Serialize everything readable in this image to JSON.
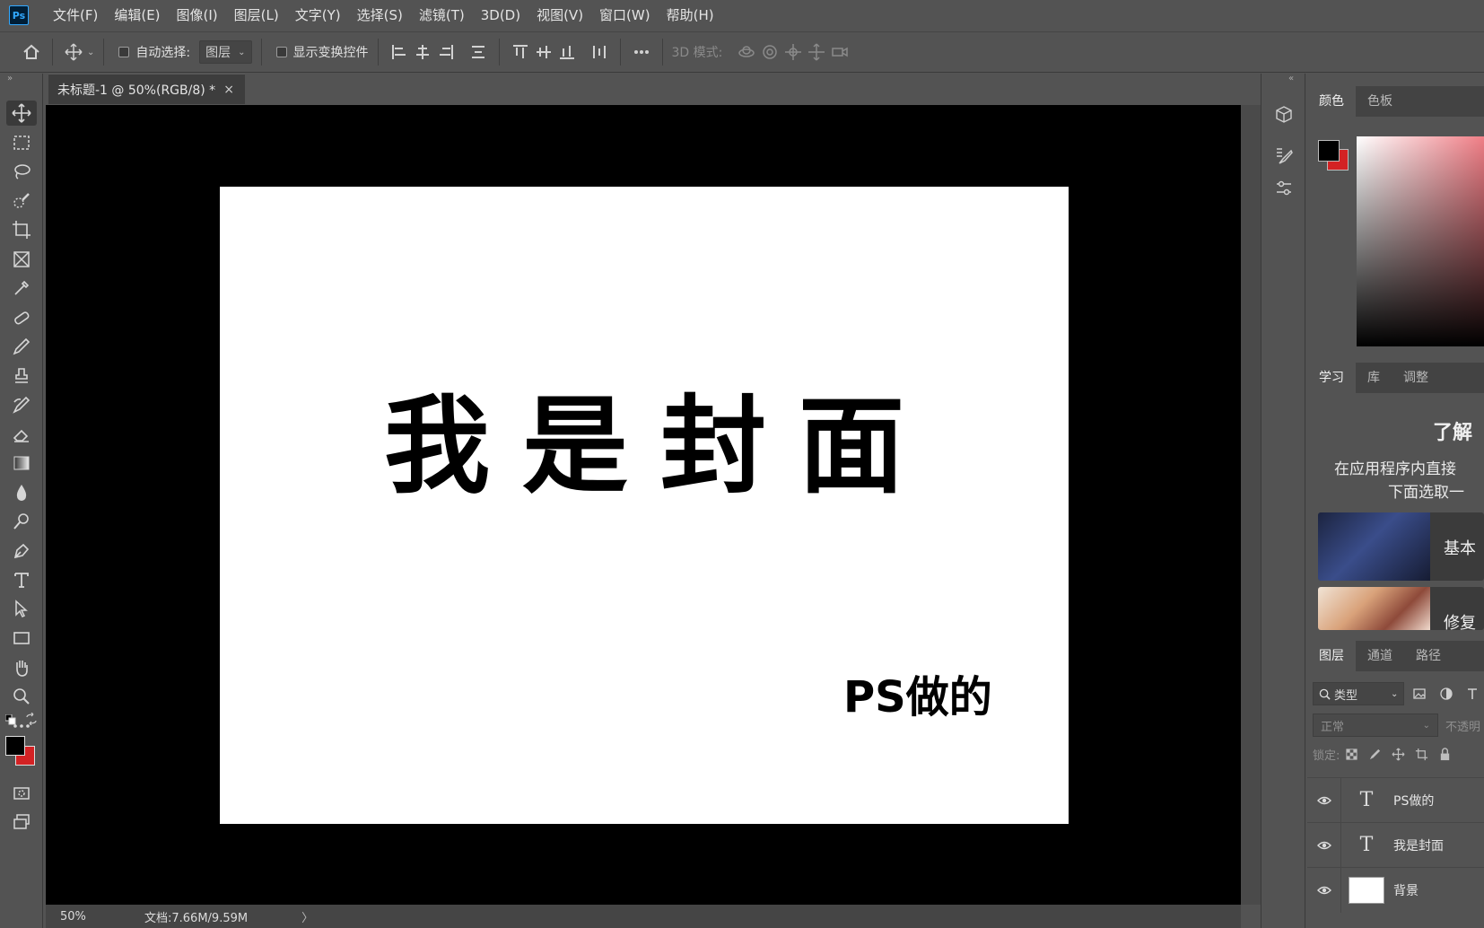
{
  "app": {
    "logo": "Ps"
  },
  "menu": [
    "文件(F)",
    "编辑(E)",
    "图像(I)",
    "图层(L)",
    "文字(Y)",
    "选择(S)",
    "滤镜(T)",
    "3D(D)",
    "视图(V)",
    "窗口(W)",
    "帮助(H)"
  ],
  "options": {
    "auto_select_label": "自动选择:",
    "auto_select_value": "图层",
    "show_transform_label": "显示变换控件",
    "mode_3d_label": "3D 模式:"
  },
  "document": {
    "tab_title": "未标题-1 @ 50%(RGB/8) *",
    "close": "×",
    "main_text": "我是封面",
    "sub_text": "PS做的"
  },
  "status": {
    "zoom": "50%",
    "doc_info": "文档:7.66M/9.59M",
    "arrow": "〉"
  },
  "color_panel": {
    "tabs": [
      "颜色",
      "色板"
    ],
    "foreground": "#000000",
    "background": "#d32224"
  },
  "learn_panel": {
    "tabs": [
      "学习",
      "库",
      "调整"
    ],
    "heading": "了解",
    "desc_line1": "在应用程序内直接",
    "desc_line2": "下面选取一",
    "cards": [
      "基本",
      "修复"
    ]
  },
  "layers_panel": {
    "tabs": [
      "图层",
      "通道",
      "路径"
    ],
    "filter_label": "类型",
    "blend_mode": "正常",
    "opacity_label": "不透明",
    "lock_label": "锁定:",
    "layers": [
      {
        "name": "PS做的",
        "type": "text",
        "thumb": "T"
      },
      {
        "name": "我是封面",
        "type": "text",
        "thumb": "T"
      },
      {
        "name": "背景",
        "type": "background"
      }
    ]
  },
  "colors": {
    "accent": "#31a8ff",
    "panel_bg": "#535353",
    "canvas_bg": "#000000"
  }
}
